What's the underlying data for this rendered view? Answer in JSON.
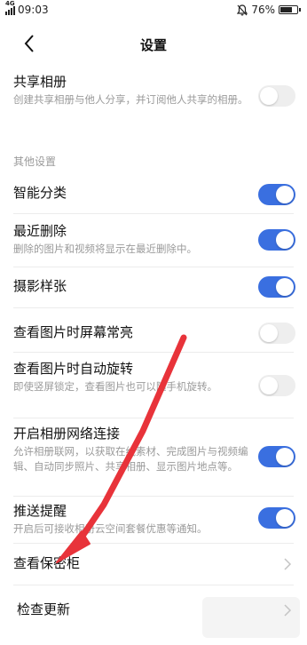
{
  "status_bar": {
    "network": "4G",
    "time": "09:03",
    "battery_pct": "76%",
    "battery_level": 0.76
  },
  "header": {
    "title": "设置"
  },
  "shared_album": {
    "title": "共享相册",
    "desc": "创建共享相册与他人分享，并订阅他人共享的相册。",
    "toggle_on": false
  },
  "section_other": {
    "label": "其他设置"
  },
  "rows": {
    "smart_classify": {
      "title": "智能分类",
      "toggle_on": true
    },
    "recently_deleted": {
      "title": "最近删除",
      "desc": "删除的图片和视频将显示在最近删除中。",
      "toggle_on": true
    },
    "photo_style": {
      "title": "摄影样张",
      "toggle_on": true
    },
    "screen_on": {
      "title": "查看图片时屏幕常亮",
      "toggle_on": false
    },
    "auto_rotate": {
      "title": "查看图片时自动旋转",
      "desc": "即使竖屏锁定，查看图片也可以随手机旋转。",
      "toggle_on": false
    },
    "network": {
      "title": "开启相册网络连接",
      "desc": "允许相册联网，以获取在线素材、完成图片与视频编辑、自动同步照片、共享相册、显示图片地点等。",
      "toggle_on": true
    },
    "push": {
      "title": "推送提醒",
      "desc": "开启后可接收相册云空间套餐优惠等通知。",
      "toggle_on": true
    },
    "safe_box": {
      "title": "查看保密柜"
    },
    "check_update": {
      "title": "检查更新"
    }
  },
  "colors": {
    "accent": "#3a6fe0",
    "annotation_arrow": "#e8333a"
  },
  "icons": [
    "signal-icon",
    "mute-icon",
    "battery-icon",
    "back-arrow-icon",
    "chevron-right-icon"
  ]
}
